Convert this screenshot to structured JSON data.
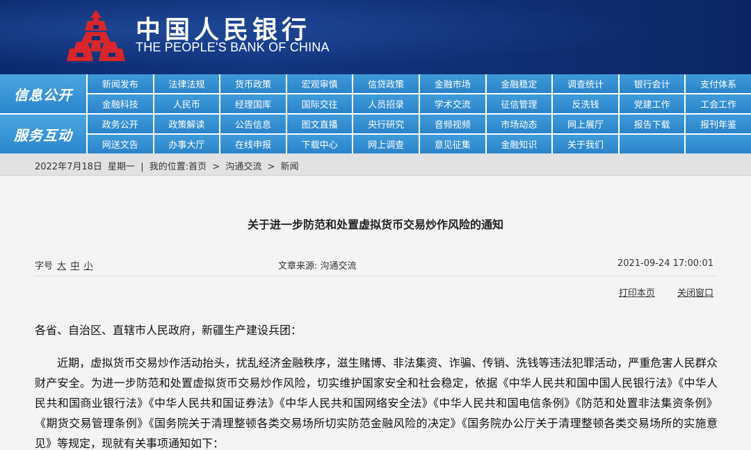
{
  "header": {
    "cn_name": "中国人民银行",
    "en_name": "THE PEOPLE'S BANK OF CHINA",
    "logo_icon": "pboc-logo-icon",
    "bg_color": "#12357f",
    "logo_color": "#d8262c"
  },
  "nav": {
    "group1": {
      "title": "信息公开",
      "items": [
        "新闻发布",
        "法律法规",
        "货币政策",
        "宏观审慎",
        "信贷政策",
        "金融市场",
        "金融稳定",
        "调查统计",
        "银行会计",
        "支付体系",
        "金融科技",
        "人民币",
        "经理国库",
        "国际交往",
        "人员招录",
        "学术交流",
        "征信管理",
        "反洗钱",
        "党建工作",
        "工会工作"
      ]
    },
    "group2": {
      "title": "服务互动",
      "items": [
        "政务公开",
        "政策解读",
        "公告信息",
        "图文直播",
        "央行研究",
        "音频视频",
        "市场动态",
        "网上展厅",
        "报告下载",
        "报刊年鉴",
        "网送文告",
        "办事大厅",
        "在线申报",
        "下载中心",
        "网上调查",
        "意见征集",
        "金融知识",
        "关于我们",
        "",
        ""
      ]
    },
    "accent_color": "#2f8ccf"
  },
  "breadcrumb": {
    "date": "2022年7月18日",
    "weekday": "星期一",
    "sep": "|",
    "prefix": "我的位置:",
    "path": [
      "首页",
      "沟通交流",
      "新闻"
    ],
    "arrow": ">"
  },
  "article": {
    "title": "关于进一步防范和处置虚拟货币交易炒作风险的通知",
    "font_label": "字号",
    "font_sizes": [
      "大",
      "中",
      "小"
    ],
    "source": "文章来源:  沟通交流",
    "date": "2021-09-24 17:00:01",
    "print_label": "打印本页",
    "close_label": "关闭窗口",
    "salutation": "各省、自治区、直辖市人民政府，新疆生产建设兵团：",
    "paragraph": "近期，虚拟货币交易炒作活动抬头，扰乱经济金融秩序，滋生赌博、非法集资、诈骗、传销、洗钱等违法犯罪活动，严重危害人民群众财产安全。为进一步防范和处置虚拟货币交易炒作风险，切实维护国家安全和社会稳定，依据《中华人民共和国中国人民银行法》《中华人民共和国商业银行法》《中华人民共和国证券法》《中华人民共和国网络安全法》《中华人民共和国电信条例》《防范和处置非法集资条例》《期货交易管理条例》《国务院关于清理整顿各类交易场所切实防范金融风险的决定》《国务院办公厅关于清理整顿各类交易场所的实施意见》等规定，现就有关事项通知如下："
  }
}
